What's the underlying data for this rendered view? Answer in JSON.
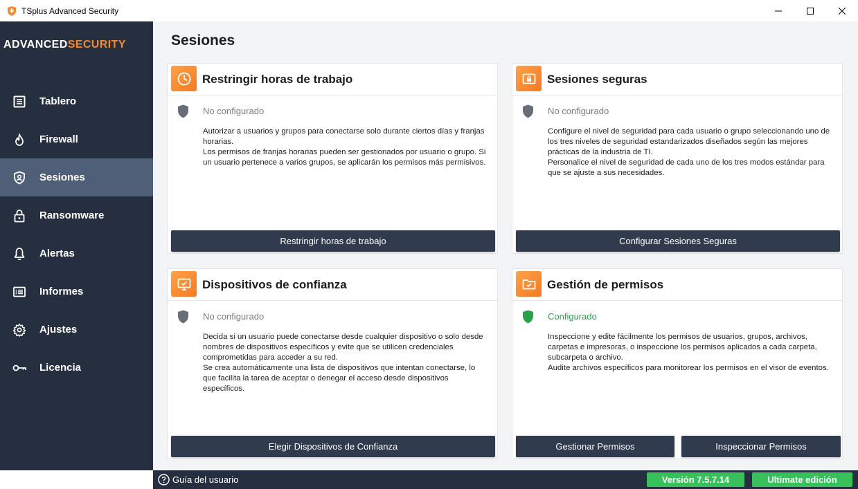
{
  "window": {
    "title": "TSplus Advanced Security"
  },
  "brand": {
    "part1": "ADVANCED",
    "part2": "SECURITY"
  },
  "sidebar": {
    "items": [
      {
        "label": "Tablero",
        "icon": "dashboard-icon"
      },
      {
        "label": "Firewall",
        "icon": "flame-icon"
      },
      {
        "label": "Sesiones",
        "icon": "shield-user-icon",
        "active": true
      },
      {
        "label": "Ransomware",
        "icon": "lock-icon"
      },
      {
        "label": "Alertas",
        "icon": "bell-icon"
      },
      {
        "label": "Informes",
        "icon": "report-icon"
      },
      {
        "label": "Ajustes",
        "icon": "gear-icon"
      },
      {
        "label": "Licencia",
        "icon": "key-icon"
      }
    ]
  },
  "main": {
    "title": "Sesiones",
    "cards": [
      {
        "title": "Restringir horas de trabajo",
        "icon": "clock-icon",
        "status": "No configurado",
        "description": [
          "Autorizar a usuarios y grupos para conectarse solo durante ciertos días y franjas horarias.",
          "Los permisos de franjas horarias pueden ser gestionados por usuario o grupo. Si un usuario pertenece a varios grupos, se aplicarán los permisos más permisivos."
        ],
        "buttons": [
          "Restringir horas de trabajo"
        ]
      },
      {
        "title": "Sesiones seguras",
        "icon": "secure-session-icon",
        "status": "No configurado",
        "description": [
          "Configure el nivel de seguridad para cada usuario o grupo seleccionando uno de los tres niveles de seguridad estandarizados diseñados según las mejores prácticas de la industria de TI.",
          "Personalice el nivel de seguridad de cada uno de los tres modos estándar para que se ajuste a sus necesidades."
        ],
        "buttons": [
          "Configurar Sesiones Seguras"
        ]
      },
      {
        "title": "Dispositivos de confianza",
        "icon": "monitor-check-icon",
        "status": "No configurado",
        "description": [
          "Decida si un usuario puede conectarse desde cualquier dispositivo o solo desde nombres de dispositivos específicos y evite que se utilicen credenciales comprometidas para acceder a su red.",
          "Se crea automáticamente una lista de dispositivos que intentan conectarse, lo que facilita la tarea de aceptar o denegar el acceso desde dispositivos específicos."
        ],
        "buttons": [
          "Elegir Dispositivos de Confianza"
        ]
      },
      {
        "title": "Gestión de permisos",
        "icon": "folder-check-icon",
        "status": "Configurado",
        "description": [
          "Inspeccione y edite fácilmente los permisos de usuarios, grupos, archivos, carpetas e impresoras, o inspeccione los permisos aplicados a cada carpeta, subcarpeta o archivo.",
          "Audite archivos específicos para monitorear los permisos en el visor de eventos."
        ],
        "buttons": [
          "Gestionar Permisos",
          "Inspeccionar Permisos"
        ]
      }
    ]
  },
  "statusbar": {
    "guide": "Guía del usuario",
    "version": "Versión 7.5.7.14",
    "edition": "Ultimate edición"
  },
  "colors": {
    "sidebar_bg": "#262f40",
    "sidebar_active": "#4f5f78",
    "accent_orange": "#f28a30",
    "button_dark": "#313b4e",
    "status_green": "#38c05a",
    "configured_green": "#2aa147"
  }
}
